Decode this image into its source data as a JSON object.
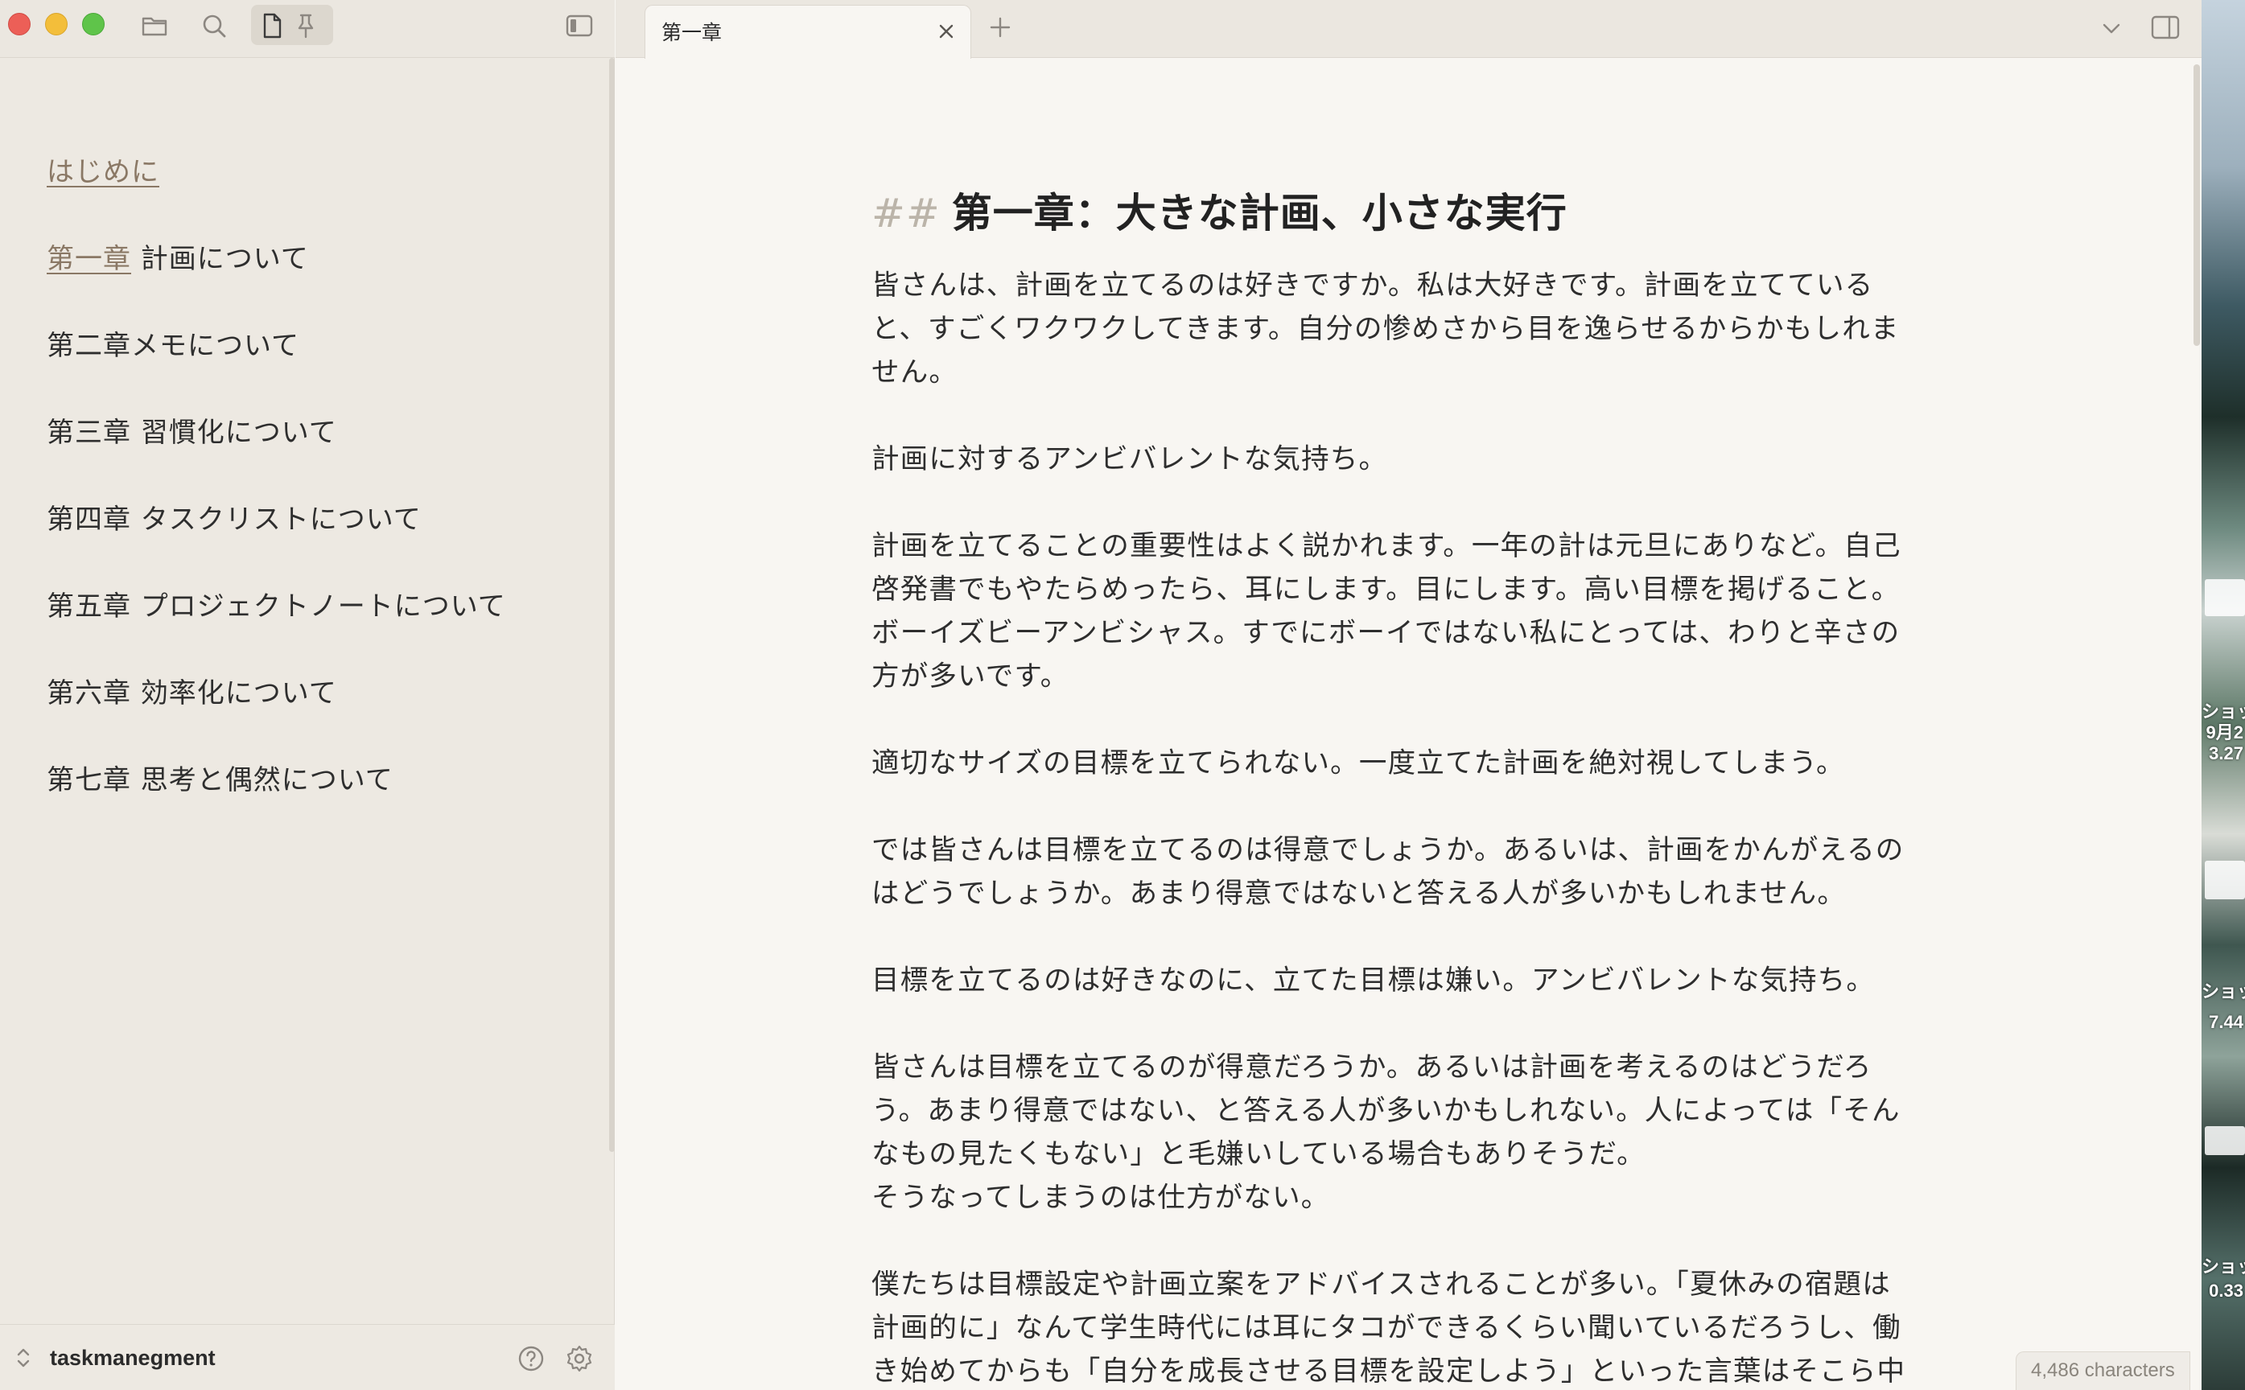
{
  "window": {
    "toolbar_icons": [
      "folder-icon",
      "search-icon",
      "file-icon",
      "pin-icon",
      "sidebar-toggle-icon"
    ]
  },
  "sidebar": {
    "items": [
      {
        "link": "はじめに",
        "rest": ""
      },
      {
        "link": "第一章",
        "rest": " 計画について"
      },
      {
        "link": "",
        "rest": "第二章メモについて"
      },
      {
        "link": "",
        "rest": "第三章 習慣化について"
      },
      {
        "link": "",
        "rest": "第四章 タスクリストについて"
      },
      {
        "link": "",
        "rest": "第五章 プロジェクトノートについて"
      },
      {
        "link": "",
        "rest": "第六章 効率化について"
      },
      {
        "link": "",
        "rest": "第七章 思考と偶然について"
      }
    ],
    "vault_name": "taskmanegment"
  },
  "tabs": [
    {
      "label": "第一章",
      "active": true
    }
  ],
  "editor": {
    "heading_marker": "##",
    "heading": "第一章：大きな計画、小さな実行",
    "paragraphs": [
      [
        "皆さんは、計画を立てるのは好きですか。私は大好きです。計画を立てている",
        "と、すごくワクワクしてきます。自分の惨めさから目を逸らせるからかもしれま",
        "せん。"
      ],
      [
        "計画に対するアンビバレントな気持ち。"
      ],
      [
        "計画を立てることの重要性はよく説かれます。一年の計は元旦にありなど。自己",
        "啓発書でもやたらめったら、耳にします。目にします。高い目標を掲げること。",
        "ボーイズビーアンビシャス。すでにボーイではない私にとっては、わりと辛さの",
        "方が多いです。"
      ],
      [
        "適切なサイズの目標を立てられない。一度立てた計画を絶対視してしまう。"
      ],
      [
        "では皆さんは目標を立てるのは得意でしょうか。あるいは、計画をかんがえるの",
        "はどうでしょうか。あまり得意ではないと答える人が多いかもしれません。"
      ],
      [
        "目標を立てるのは好きなのに、立てた目標は嫌い。アンビバレントな気持ち。"
      ],
      [
        "皆さんは目標を立てるのが得意だろうか。あるいは計画を考えるのはどうだろ",
        "う。あまり得意ではない、と答える人が多いかもしれない。人によっては「そん",
        "なもの見たくもない」と毛嫌いしている場合もありそうだ。",
        "そうなってしまうのは仕方がない。"
      ],
      [
        "僕たちは目標設定や計画立案をアドバイスされることが多い。「夏休みの宿題は",
        "計画的に」なんて学生時代には耳にタコができるくらい聞いているだろうし、働",
        "き始めてからも「自分を成長させる目標を設定しよう」といった言葉はそこら中"
      ]
    ]
  },
  "status": {
    "characters": "4,486 characters"
  },
  "desktop": {
    "snippets": [
      "ショッ",
      "9月2",
      "3.27",
      "ショッ",
      "7.44",
      "ショッ",
      "0.33"
    ]
  },
  "colors": {
    "link": "#8a7865",
    "sidebar_bg": "#ede9e2",
    "editor_bg": "#f8f6f2",
    "traffic_close": "#ec5f57",
    "traffic_min": "#f3be3a",
    "traffic_max": "#5fc44a"
  }
}
